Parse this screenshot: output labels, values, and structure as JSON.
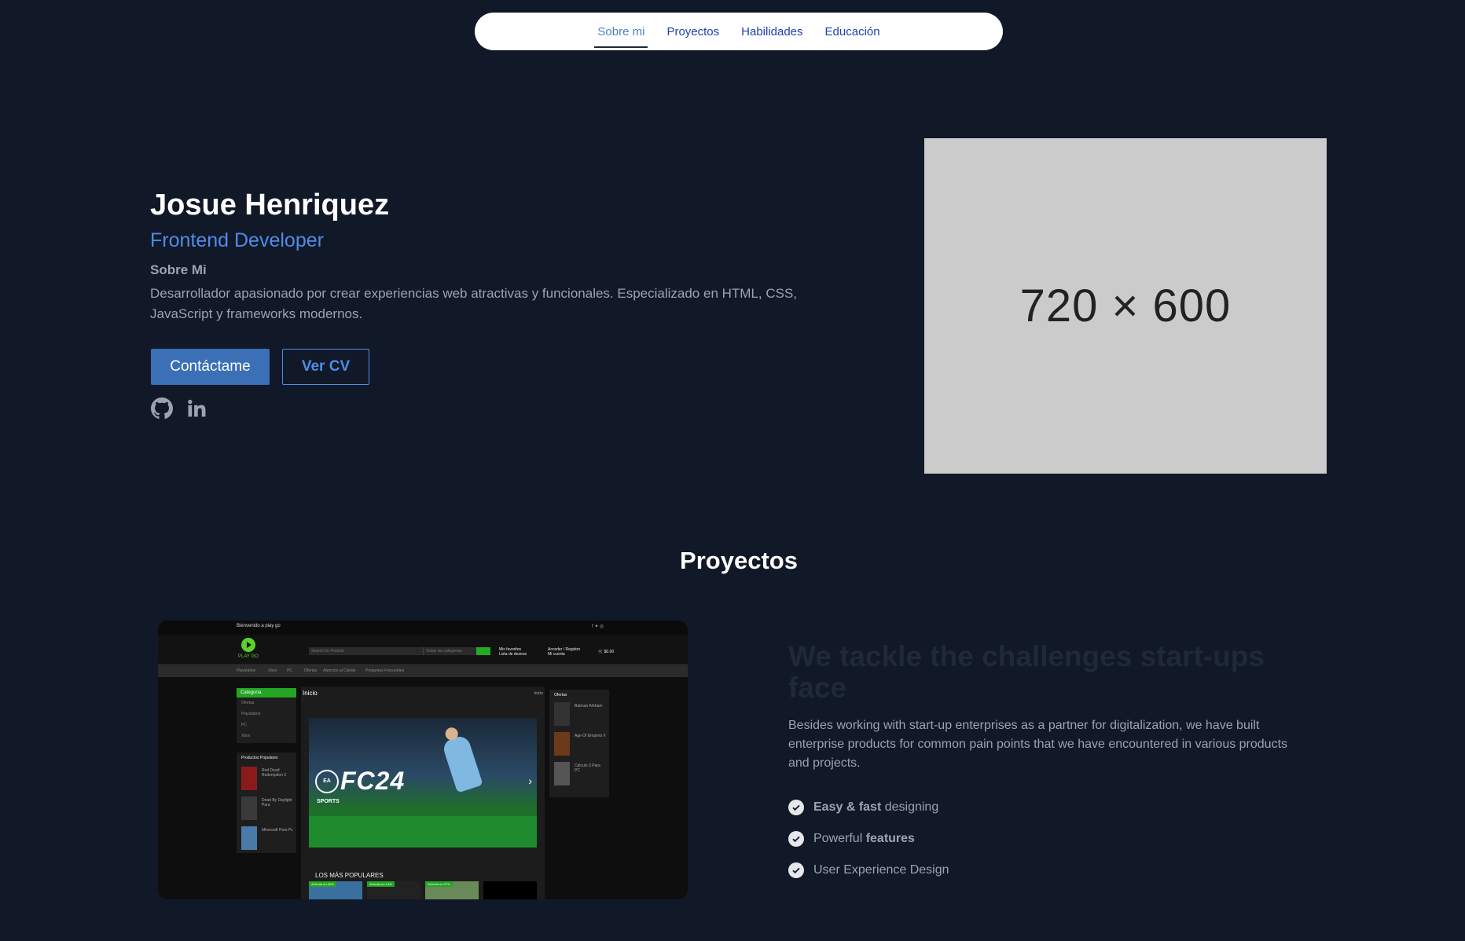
{
  "nav": {
    "items": [
      "Sobre mi",
      "Proyectos",
      "Habilidades",
      "Educación"
    ],
    "active": "Sobre mi"
  },
  "hero": {
    "name": "Josue Henriquez",
    "role": "Frontend Developer",
    "about_title": "Sobre Mi",
    "about_text": "Desarrollador apasionado por crear experiencias web atractivas y funcionales. Especializado en HTML, CSS, JavaScript y frameworks modernos.",
    "contact_button": "Contáctame",
    "cv_button": "Ver CV",
    "social": [
      "github-icon",
      "linkedin-icon"
    ],
    "image_placeholder": "720 × 600"
  },
  "projects": {
    "title": "Proyectos",
    "screenshot": {
      "welcome": "Bienvenido a play go",
      "logo": "PLAY GO",
      "search_placeholder": "Search for Product",
      "category_placeholder": "Todas las categorías",
      "wishlist_label": "Mis favoritos",
      "wishlist_sub": "Lista de deseos",
      "account_label": "Acceder / Registro",
      "account_sub": "Mi cuenta",
      "cart_total": "$0.00",
      "menu": [
        "Playstation",
        "Xbox",
        "PC",
        "Ofertas",
        "Atención al Cliente",
        "Preguntas Frecuentes"
      ],
      "category_header": "Categoría",
      "categories": [
        "Ofertas",
        "Playstation",
        "PC",
        "Xbox"
      ],
      "popular_title": "Productos Populares",
      "popular": [
        "Red Dead Redemption 2",
        "Dead By Daylight Para",
        "Minecraft Para Pc"
      ],
      "main_title": "Inicio",
      "main_breadcrumb": "Inicio",
      "banner_text": "FC24",
      "banner_brand": "EA SPORTS",
      "most_popular": "LOS MÁS POPULARES",
      "tags": [
        "Ahorras un 40%",
        "Ahorras un 14%",
        "Ahorras un 37%"
      ],
      "offers_title": "Ofertas",
      "offers": [
        "Batman Arkham",
        "Age Of Empires II",
        "Cálculo 3 Para PC"
      ]
    }
  },
  "feature": {
    "title": "We tackle the challenges start-ups face",
    "text": "Besides working with start-up enterprises as a partner for digitalization, we have built enterprise products for common pain points that we have encountered in various products and projects.",
    "items": [
      {
        "bold": "Easy & fast",
        "rest": " designing"
      },
      {
        "pre": "Powerful ",
        "bold": "features"
      },
      {
        "plain": "User Experience Design"
      }
    ]
  },
  "colors": {
    "background": "#111827",
    "accent": "#4f8ce8",
    "primary_button": "#3b6fb6",
    "store_green": "#24a524"
  }
}
